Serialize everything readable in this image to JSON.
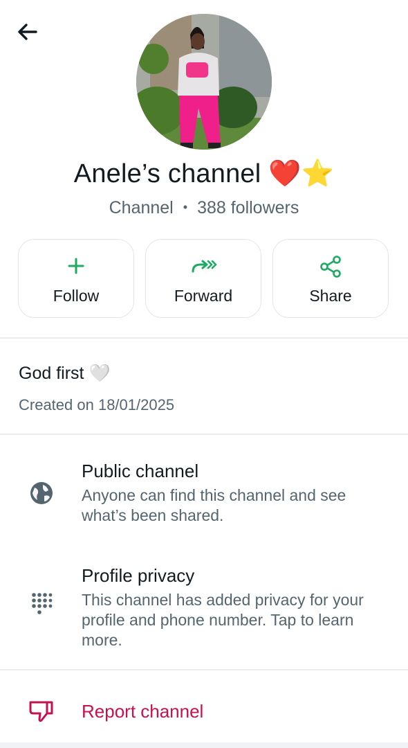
{
  "header": {
    "back_icon": "arrow-left-icon"
  },
  "channel": {
    "name": "Anele’s channel",
    "name_emoji": "❤️⭐",
    "type": "Channel",
    "followers": "388 followers",
    "description": "God first",
    "description_emoji": "🤍",
    "created": "Created on 18/01/2025"
  },
  "actions": {
    "follow": {
      "label": "Follow",
      "icon": "plus-icon"
    },
    "forward": {
      "label": "Forward",
      "icon": "forward-icon"
    },
    "share": {
      "label": "Share",
      "icon": "share-icon"
    }
  },
  "info": {
    "public": {
      "title": "Public channel",
      "text": "Anyone can find this channel and see what’s been shared.",
      "icon": "globe-icon"
    },
    "privacy": {
      "title": "Profile privacy",
      "text": "This channel has added privacy for your profile and phone number. Tap to learn more.",
      "icon": "dialpad-icon"
    }
  },
  "report": {
    "label": "Report channel",
    "icon": "thumbs-down-icon"
  },
  "colors": {
    "accent": "#1daa61",
    "danger": "#c5114f",
    "muted": "#54656f",
    "text": "#111b21",
    "border": "#e3e6e8"
  }
}
